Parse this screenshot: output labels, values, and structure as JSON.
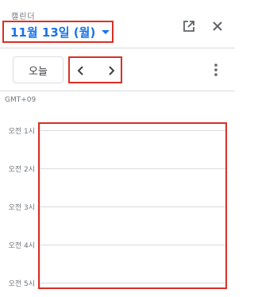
{
  "header": {
    "app_label": "캘린더",
    "date_label": "11월 13일 (월)"
  },
  "toolbar": {
    "today_label": "오늘"
  },
  "schedule": {
    "timezone": "GMT+09",
    "hours": [
      "오전 1시",
      "오전 2시",
      "오전 3시",
      "오전 4시",
      "오전 5시"
    ]
  },
  "colors": {
    "accent": "#1a73e8",
    "highlight": "#d93025",
    "icon": "#5f6368",
    "divider": "#dadce0"
  }
}
